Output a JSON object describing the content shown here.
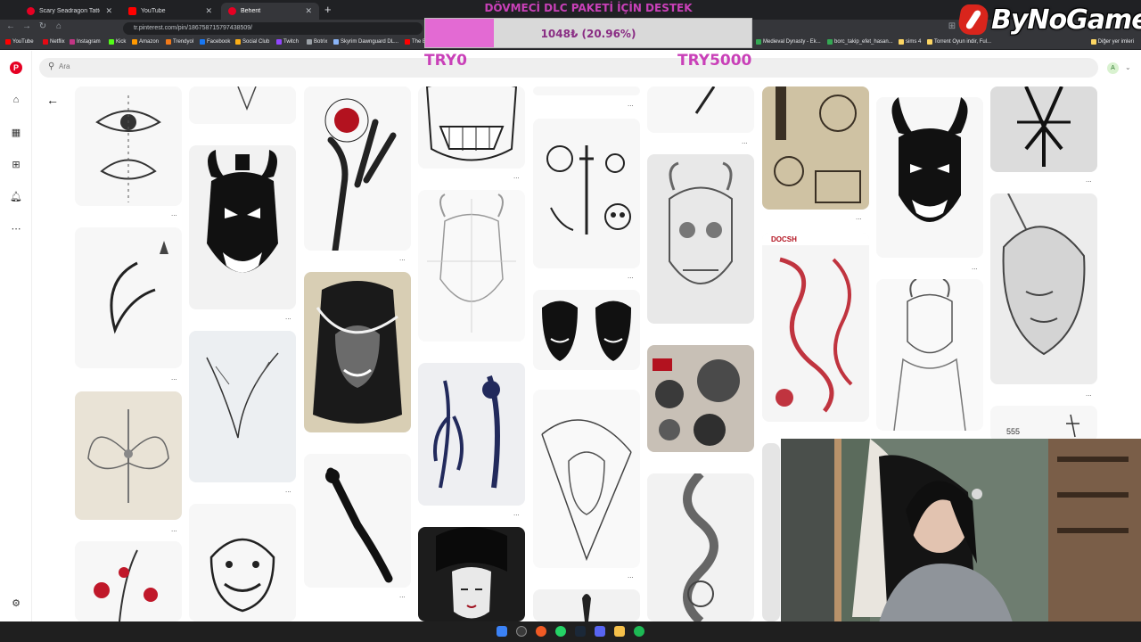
{
  "browser": {
    "tabs": [
      {
        "title": "Scary Seadragon Tattoo Stencil",
        "active": false,
        "icon": "pinterest-icon"
      },
      {
        "title": "YouTube",
        "active": false,
        "icon": "youtube-icon"
      },
      {
        "title": "Beherit",
        "active": true,
        "icon": "pinterest-icon"
      }
    ],
    "new_tab_label": "+",
    "url": "tr.pinterest.com/pin/186758715797438509/",
    "bookmarks": [
      "YouTube",
      "Netflix",
      "Instagram",
      "Kick",
      "Amazon",
      "Trendyol",
      "Facebook",
      "Social Club",
      "Twitch",
      "Botrix",
      "Skyrim Dawnguard DL...",
      "The E",
      "Medieval Dynasty - Ek...",
      "borc_takip_efet_hasan...",
      "sims 4",
      "Torrent Oyun indir, Ful..."
    ],
    "other_bookmarks": "Diğer yer imleri"
  },
  "pinterest": {
    "search_placeholder": "Ara",
    "avatar_letter": "A",
    "logo_letter": "P",
    "sidebar_icons": [
      "pinterest-logo-icon",
      "home-icon",
      "explore-icon",
      "create-icon",
      "notifications-icon",
      "messages-icon",
      "settings-icon"
    ],
    "pin_more_label": "..."
  },
  "overlay": {
    "donation_title": "DÖVMECİ DLC PAKETİ İÇİN DESTEK",
    "donation_amount": "1048₺ (20.96%)",
    "donation_progress": 0.2096,
    "donation_min": "TRY0",
    "donation_max": "TRY5000",
    "brand": "ByNoGame",
    "colors": {
      "accent": "#c940b8",
      "bar_fill": "#e36ad3",
      "brand_red": "#d9251c"
    }
  },
  "pin_labels": {
    "dragon_sheet_tag": "DOCSH",
    "small_tag": "555"
  }
}
